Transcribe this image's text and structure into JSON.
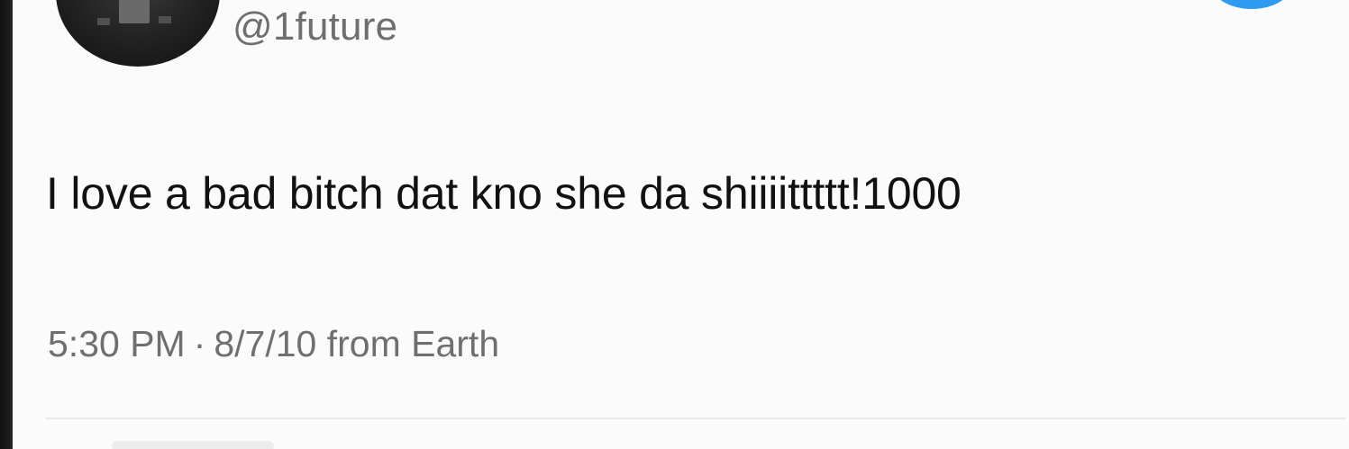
{
  "tweet": {
    "handle": "@1future",
    "text": "I love a bad bitch dat kno she da shiiiittttt!1000",
    "time": "5:30 PM",
    "separator": "·",
    "date_source": "8/7/10 from Earth"
  },
  "icons": {
    "avatar": "profile-avatar-icon",
    "verified": "verified-badge-icon"
  },
  "colors": {
    "background": "#fbfbfb",
    "text": "#111111",
    "muted": "#6f6f6f",
    "verified": "#2e9bf0"
  }
}
